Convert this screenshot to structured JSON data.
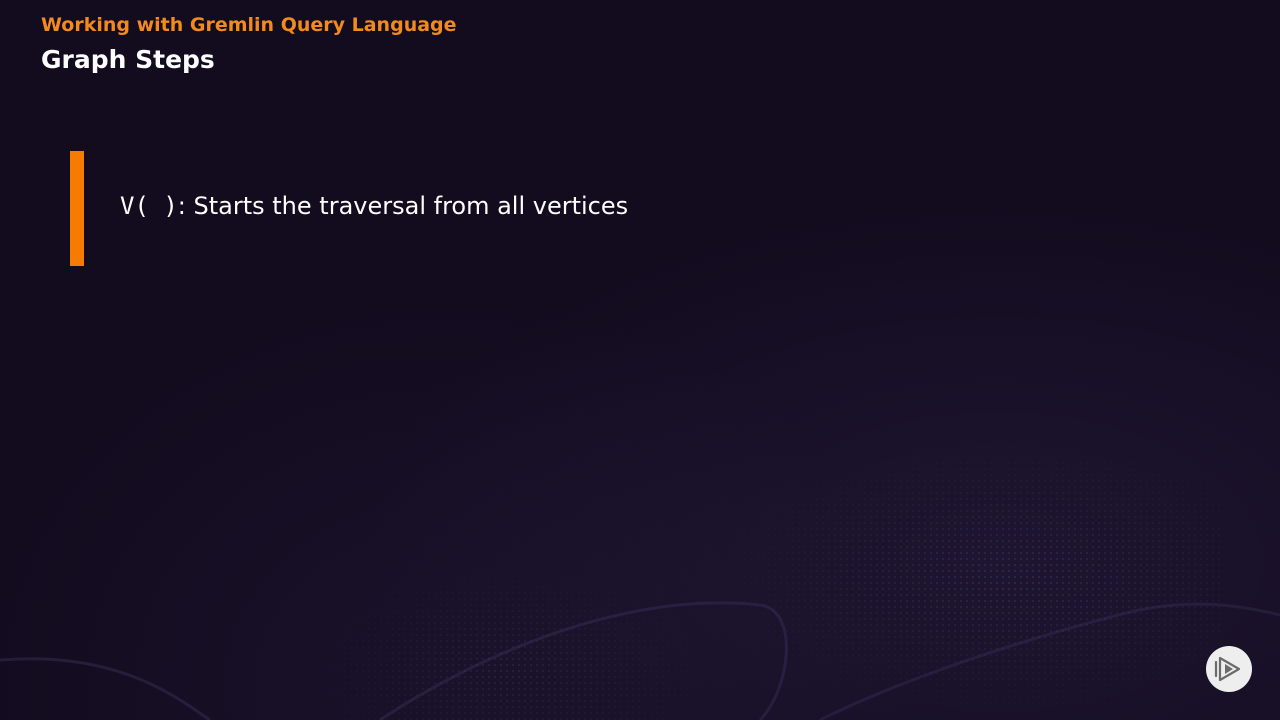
{
  "header": {
    "course_title": "Working with Gremlin Query Language",
    "module_title": "Graph Steps"
  },
  "content": {
    "bullet_code": "V( )",
    "bullet_text": ": Starts the traversal from all vertices"
  },
  "colors": {
    "background": "#130c1f",
    "accent_orange": "#f28a1d",
    "bar_orange": "#f57c00",
    "text_white": "#ffffff"
  },
  "icons": {
    "brand_logo": "play-logo-icon"
  }
}
